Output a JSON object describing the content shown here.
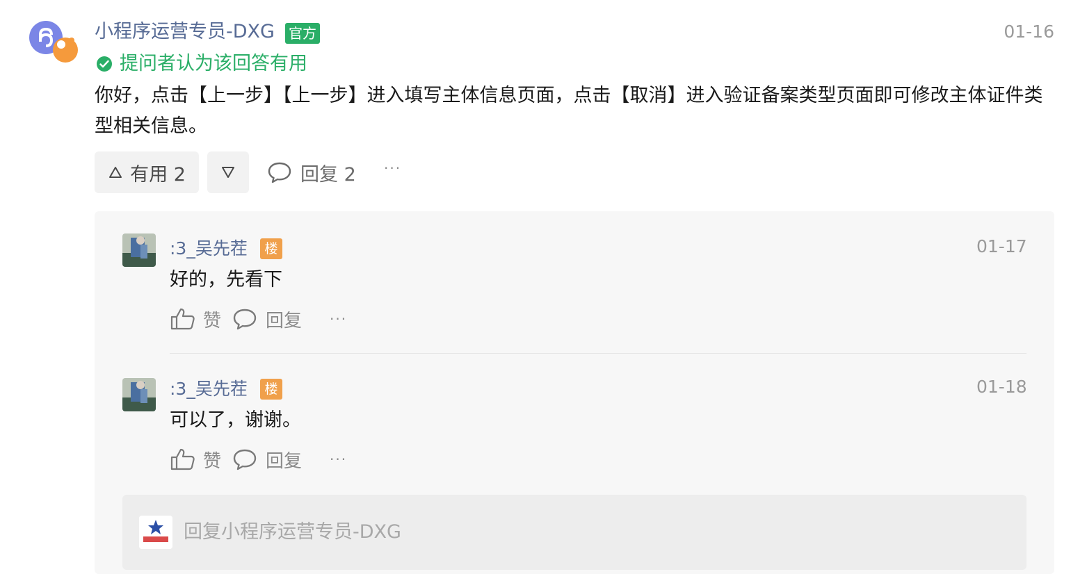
{
  "answer": {
    "author": "小程序运营专员-DXG",
    "official_badge": "官方",
    "date": "01-16",
    "accepted_label": "提问者认为该回答有用",
    "text": "你好，点击【上一步】【上一步】进入填写主体信息页面，点击【取消】进入验证备案类型页面即可修改主体证件类型相关信息。",
    "useful_label": "有用 2",
    "reply_label": "回复 2",
    "more": "···"
  },
  "replies": [
    {
      "author": ":3_吴先茬",
      "floor_badge": "楼",
      "date": "01-17",
      "text": "好的，先看下",
      "like_label": "赞",
      "reply_label": "回复",
      "more": "···"
    },
    {
      "author": ":3_吴先茬",
      "floor_badge": "楼",
      "date": "01-18",
      "text": "可以了，谢谢。",
      "like_label": "赞",
      "reply_label": "回复",
      "more": "···"
    }
  ],
  "reply_input": {
    "placeholder": "回复小程序运营专员-DXG"
  },
  "colors": {
    "name_blue": "#576b95",
    "accepted_green": "#2aae67",
    "floor_orange": "#f0a04b",
    "panel_bg": "#f7f7f7"
  }
}
